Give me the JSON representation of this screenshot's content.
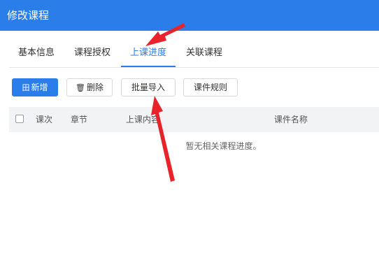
{
  "dialog": {
    "title": "修改课程"
  },
  "tabs": [
    {
      "label": "基本信息"
    },
    {
      "label": "课程授权"
    },
    {
      "label": "上课进度"
    },
    {
      "label": "关联课程"
    }
  ],
  "active_tab": "上课进度",
  "toolbar": {
    "add_label": "新增",
    "add_icon": "grid-plus-icon",
    "delete_label": "删除",
    "delete_icon": "trash-icon",
    "import_label": "批量导入",
    "rules_label": "课件规则"
  },
  "table": {
    "columns": [
      "课次",
      "章节",
      "上课内容",
      "课件名称"
    ],
    "empty_text": "暂无相关课程进度。"
  },
  "colors": {
    "accent": "#2b7de9",
    "annotation": "#e8232a"
  }
}
